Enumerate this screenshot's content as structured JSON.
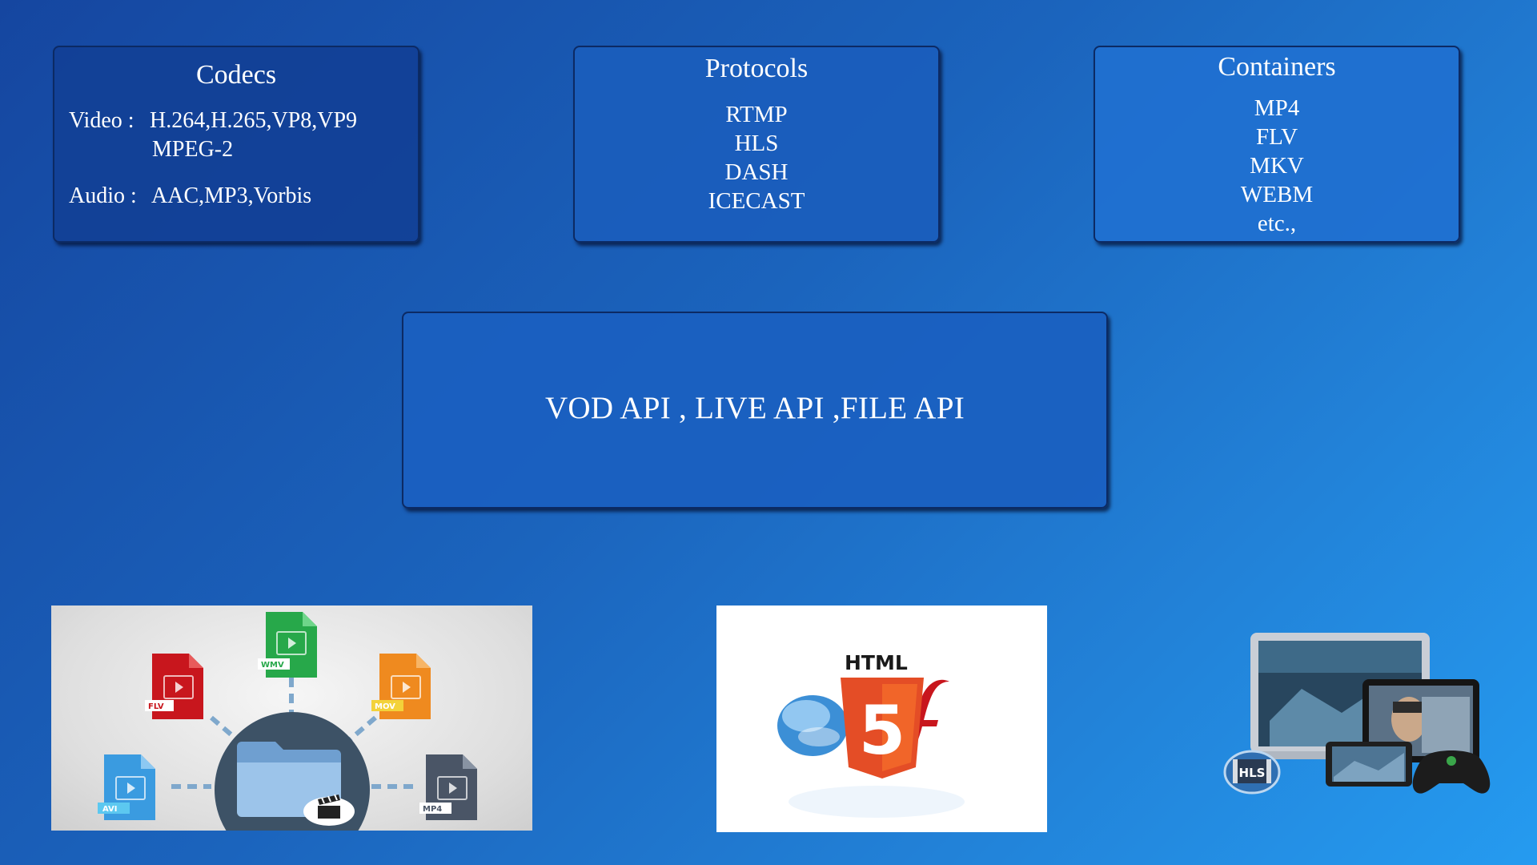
{
  "codecs": {
    "title": "Codecs",
    "video_label": "Video :",
    "video_values": "H.264,H.265,VP8,VP9",
    "video_values_2": "MPEG-2",
    "audio_label": "Audio :",
    "audio_values": "AAC,MP3,Vorbis"
  },
  "protocols": {
    "title": "Protocols",
    "items": [
      "RTMP",
      "HLS",
      "DASH",
      "ICECAST"
    ]
  },
  "containers": {
    "title": "Containers",
    "items": [
      "MP4",
      "FLV",
      "MKV",
      "WEBM",
      "etc.,"
    ]
  },
  "api": {
    "text": "VOD API , LIVE API ,FILE API"
  },
  "formats_image": {
    "labels": [
      "FLV",
      "WMV",
      "MOV",
      "AVI",
      "MP4"
    ],
    "colors": {
      "flv": "#c8161d",
      "wmv": "#27a84a",
      "mov": "#ef8a1f",
      "avi": "#3a9be0",
      "mp4": "#4a5566",
      "hub": "#3d5266",
      "folder": "#8fb8e0",
      "connector": "#7fa8cc"
    }
  },
  "html5_image": {
    "heading": "HTML",
    "digit": "5",
    "colors": {
      "shield": "#e44d26",
      "shield_light": "#f16529",
      "flash": "#c8161d",
      "silverlight": "#3c8fd6"
    }
  },
  "devices_image": {
    "badge": "HLS"
  }
}
